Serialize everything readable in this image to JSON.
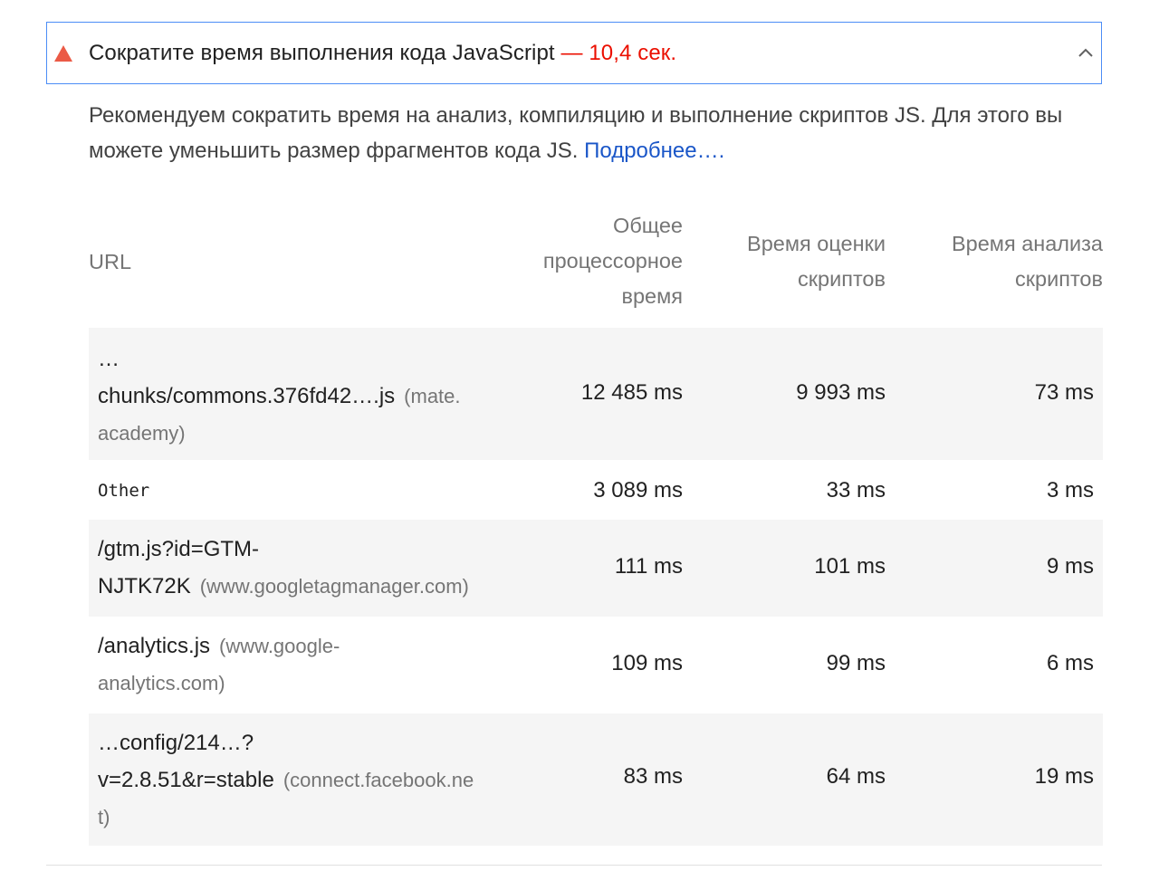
{
  "audit": {
    "title": "Сократите время выполнения кода JavaScript",
    "value": "— 10,4 сек.",
    "status_color": "#eb0f00",
    "accent_color": "#4c8df6",
    "icon": "warning-triangle-icon",
    "toggle_icon": "chevron-up-icon"
  },
  "description": {
    "text": "Рекомендуем сократить время на анализ, компиляцию и выполнение скриптов JS. Для этого вы можете уменьшить размер фрагментов кода JS. ",
    "link": "Подробнее…."
  },
  "table": {
    "headers": {
      "url": "URL",
      "total_line1": "Общее",
      "total_line2": "процессорное",
      "total_line3": "время",
      "eval_line1": "Время оценки",
      "eval_line2": "скриптов",
      "parse_line1": "Время анализа",
      "parse_line2": "скриптов"
    },
    "rows": [
      {
        "url_line1": "…",
        "url_line2": "chunks/commons.376fd42….js",
        "host_line1": "(mate.",
        "host_line2": "academy)",
        "total": "12 485 ms",
        "eval": "9 993 ms",
        "parse": "73 ms"
      },
      {
        "url": "Other",
        "total": "3 089 ms",
        "eval": "33 ms",
        "parse": "3 ms"
      },
      {
        "url_line1": "/gtm.js?id=GTM-",
        "url_line2": "NJTK72K",
        "host": "(www.googletagmanager.com)",
        "total": "111 ms",
        "eval": "101 ms",
        "parse": "9 ms"
      },
      {
        "url": "/analytics.js",
        "host_line1": "(www.google-",
        "host_line2": "analytics.com)",
        "total": "109 ms",
        "eval": "99 ms",
        "parse": "6 ms"
      },
      {
        "url_line1": "…config/214…?",
        "url_line2": "v=2.8.51&r=stable",
        "host_line1": "(connect.facebook.ne",
        "host_line2": "t)",
        "total": "83 ms",
        "eval": "64 ms",
        "parse": "19 ms"
      }
    ]
  }
}
